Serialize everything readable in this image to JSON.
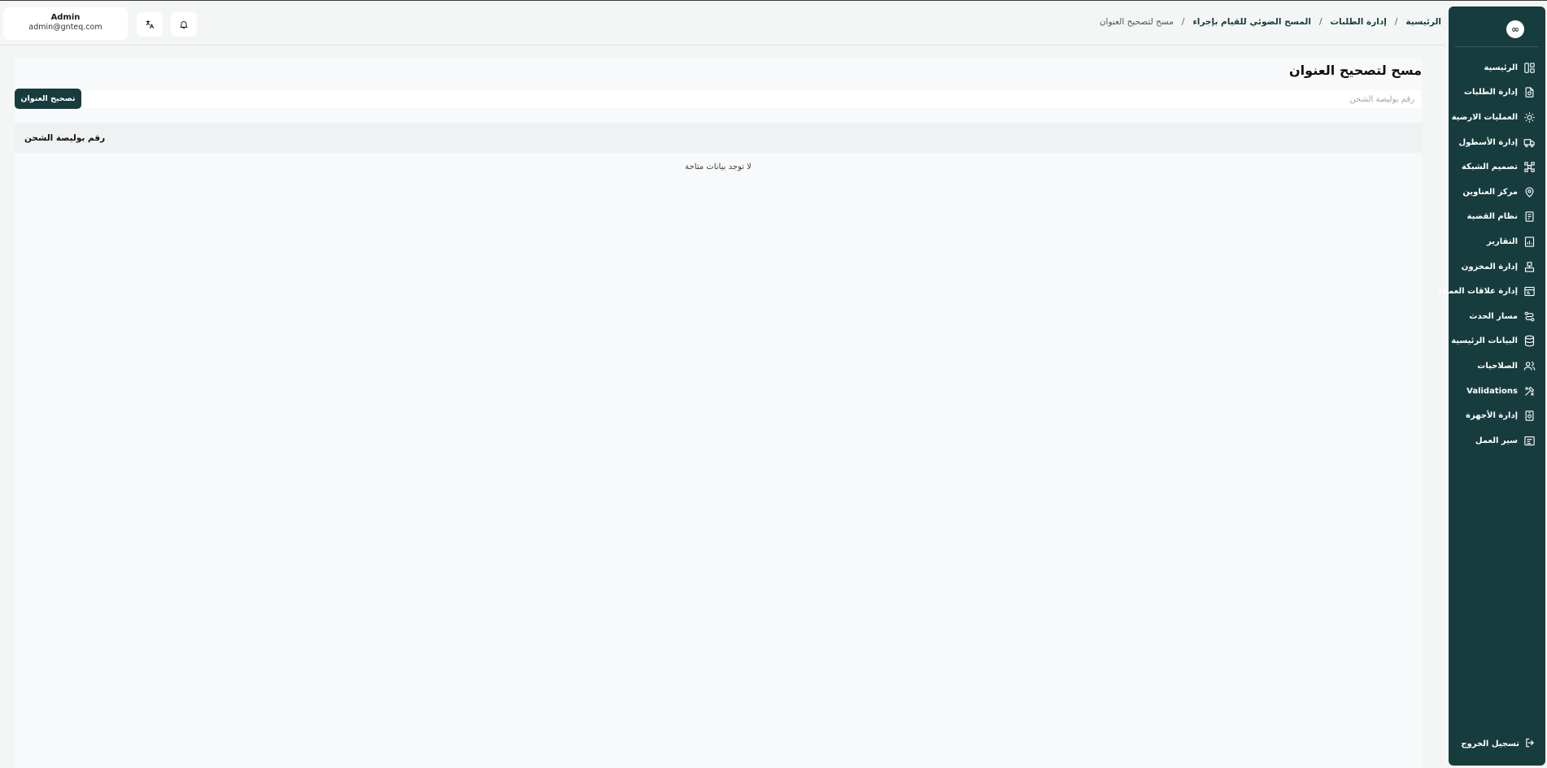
{
  "sidebar": {
    "logo_text": "∞",
    "items": [
      {
        "label": "الرئيسية",
        "icon": "home-layout-icon"
      },
      {
        "label": "إدارة الطلبات",
        "icon": "orders-icon"
      },
      {
        "label": "العمليات الارضية",
        "icon": "ground-operations-icon"
      },
      {
        "label": "إدارة الأسطول",
        "icon": "truck-icon"
      },
      {
        "label": "تصميم الشبكة",
        "icon": "network-icon"
      },
      {
        "label": "مركز العناوين",
        "icon": "location-pin-icon"
      },
      {
        "label": "نظام القضية",
        "icon": "case-icon"
      },
      {
        "label": "التقارير",
        "icon": "reports-icon"
      },
      {
        "label": "إدارة المخزون",
        "icon": "inventory-icon"
      },
      {
        "label": "إدارة علاقات العملاء",
        "icon": "crm-icon"
      },
      {
        "label": "مسار الحدث",
        "icon": "route-icon"
      },
      {
        "label": "البيانات الرئيسية",
        "icon": "database-icon"
      },
      {
        "label": "الصلاحيات",
        "icon": "users-icon"
      },
      {
        "label": "Validations",
        "icon": "tools-icon"
      },
      {
        "label": "إدارة الأجهزة",
        "icon": "device-icon"
      },
      {
        "label": "سير العمل",
        "icon": "workflow-icon"
      }
    ],
    "logout_label": "تسجيل الخروج"
  },
  "header": {
    "user_name": "Admin",
    "user_email": "admin@gnteq.com",
    "breadcrumb": {
      "home": "الرئيسية",
      "orders": "إدارة الطلبات",
      "scan": "المسح الضوئي للقيام بإجراء",
      "current": "مسح لتصحيح العنوان",
      "separator": "/"
    }
  },
  "main": {
    "title": "مسح لتصحيح العنوان",
    "search_placeholder": "رقم بوليصة الشحن",
    "search_value": "",
    "fix_button_label": "تصحيح العنوان",
    "table": {
      "columns": [
        "رقم بوليصة الشحن"
      ],
      "empty_message": "لا توجد بيانات متاحة"
    }
  },
  "colors": {
    "sidebar_bg": "#173c3e",
    "primary": "#173c3e",
    "page_bg": "#f4f6f6"
  }
}
